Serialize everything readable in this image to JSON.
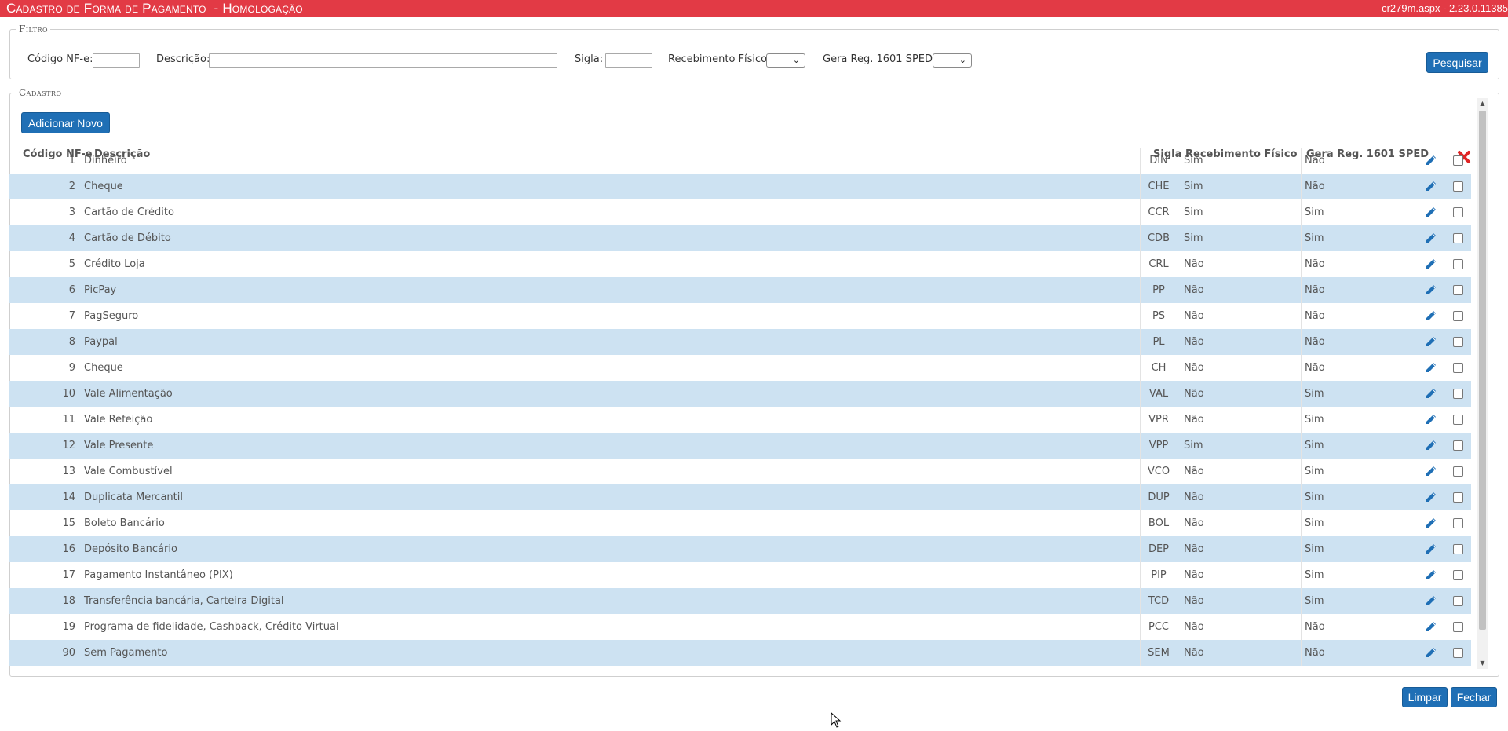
{
  "titlebar": {
    "title": "Cadastro de Forma de Pagamento  - Homologação",
    "version": "cr279m.aspx - 2.23.0.11385",
    "color": "#e23a45"
  },
  "filter": {
    "legend": "Filtro",
    "codigo_label": "Código NF-e:",
    "codigo_value": "",
    "descricao_label": "Descrição:",
    "descricao_value": "",
    "sigla_label": "Sigla:",
    "sigla_value": "",
    "recebimento_label": "Recebimento Físico?",
    "recebimento_value": "",
    "gera_label": "Gera Reg. 1601 SPED?",
    "gera_value": "",
    "search_button": "Pesquisar"
  },
  "cadastro": {
    "legend": "Cadastro",
    "add_button": "Adicionar Novo",
    "columns": {
      "codigo": "Código NF-e",
      "descricao": "Descrição",
      "sigla": "Sigla",
      "recebimento": "Recebimento Físico",
      "gera": "Gera Reg. 1601 SPED"
    },
    "delete_icon": "delete-x-icon",
    "edit_icon": "pencil-icon",
    "rows": [
      {
        "codigo": "1",
        "descricao": "Dinheiro",
        "sigla": "DIN",
        "recebimento": "Sim",
        "gera": "Não"
      },
      {
        "codigo": "2",
        "descricao": "Cheque",
        "sigla": "CHE",
        "recebimento": "Sim",
        "gera": "Não"
      },
      {
        "codigo": "3",
        "descricao": "Cartão de Crédito",
        "sigla": "CCR",
        "recebimento": "Sim",
        "gera": "Sim"
      },
      {
        "codigo": "4",
        "descricao": "Cartão de Débito",
        "sigla": "CDB",
        "recebimento": "Sim",
        "gera": "Sim"
      },
      {
        "codigo": "5",
        "descricao": "Crédito Loja",
        "sigla": "CRL",
        "recebimento": "Não",
        "gera": "Não"
      },
      {
        "codigo": "6",
        "descricao": "PicPay",
        "sigla": "PP",
        "recebimento": "Não",
        "gera": "Não"
      },
      {
        "codigo": "7",
        "descricao": "PagSeguro",
        "sigla": "PS",
        "recebimento": "Não",
        "gera": "Não"
      },
      {
        "codigo": "8",
        "descricao": "Paypal",
        "sigla": "PL",
        "recebimento": "Não",
        "gera": "Não"
      },
      {
        "codigo": "9",
        "descricao": "Cheque",
        "sigla": "CH",
        "recebimento": "Não",
        "gera": "Não"
      },
      {
        "codigo": "10",
        "descricao": "Vale Alimentação",
        "sigla": "VAL",
        "recebimento": "Não",
        "gera": "Sim"
      },
      {
        "codigo": "11",
        "descricao": "Vale Refeição",
        "sigla": "VPR",
        "recebimento": "Não",
        "gera": "Sim"
      },
      {
        "codigo": "12",
        "descricao": "Vale Presente",
        "sigla": "VPP",
        "recebimento": "Sim",
        "gera": "Sim"
      },
      {
        "codigo": "13",
        "descricao": "Vale Combustível",
        "sigla": "VCO",
        "recebimento": "Não",
        "gera": "Sim"
      },
      {
        "codigo": "14",
        "descricao": "Duplicata Mercantil",
        "sigla": "DUP",
        "recebimento": "Não",
        "gera": "Sim"
      },
      {
        "codigo": "15",
        "descricao": "Boleto Bancário",
        "sigla": "BOL",
        "recebimento": "Não",
        "gera": "Sim"
      },
      {
        "codigo": "16",
        "descricao": "Depósito Bancário",
        "sigla": "DEP",
        "recebimento": "Não",
        "gera": "Sim"
      },
      {
        "codigo": "17",
        "descricao": "Pagamento Instantâneo (PIX)",
        "sigla": "PIP",
        "recebimento": "Não",
        "gera": "Sim"
      },
      {
        "codigo": "18",
        "descricao": "Transferência bancária, Carteira Digital",
        "sigla": "TCD",
        "recebimento": "Não",
        "gera": "Sim"
      },
      {
        "codigo": "19",
        "descricao": "Programa de fidelidade, Cashback, Crédito Virtual",
        "sigla": "PCC",
        "recebimento": "Não",
        "gera": "Não"
      },
      {
        "codigo": "90",
        "descricao": "Sem Pagamento",
        "sigla": "SEM",
        "recebimento": "Não",
        "gera": "Não"
      }
    ]
  },
  "footer": {
    "clear_button": "Limpar",
    "close_button": "Fechar"
  }
}
